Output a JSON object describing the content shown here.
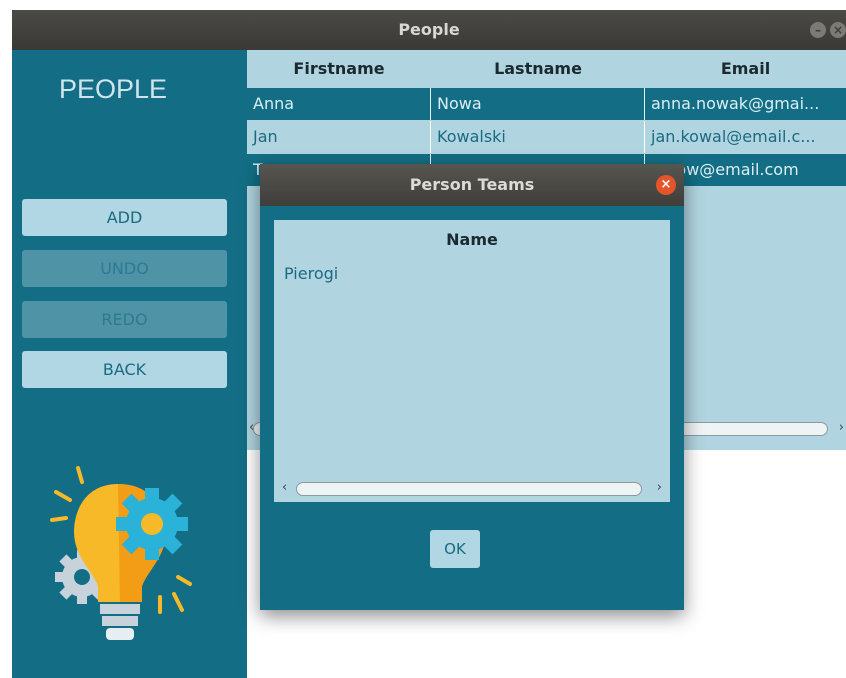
{
  "window": {
    "title": "People"
  },
  "sidebar": {
    "heading": "PEOPLE",
    "buttons": [
      {
        "label": "ADD",
        "enabled": true
      },
      {
        "label": "UNDO",
        "enabled": false
      },
      {
        "label": "REDO",
        "enabled": false
      },
      {
        "label": "BACK",
        "enabled": true
      }
    ],
    "illustration_icon": "lightbulb-gears-icon"
  },
  "table": {
    "columns": [
      "Firstname",
      "Lastname",
      "Email"
    ],
    "rows": [
      {
        "firstname": "Anna",
        "lastname": "Nowa",
        "email": "anna.nowak@gmai..."
      },
      {
        "firstname": "Jan",
        "lastname": "Kowalski",
        "email": "jan.kowal@email.c..."
      },
      {
        "firstname": "T",
        "lastname": "",
        "email": "...now@email.com"
      }
    ]
  },
  "dialog": {
    "title": "Person Teams",
    "column": "Name",
    "items": [
      "Pierogi"
    ],
    "ok_label": "OK"
  },
  "colors": {
    "accent": "#136e85",
    "light": "#b1d5e0",
    "close": "#e4552b"
  }
}
